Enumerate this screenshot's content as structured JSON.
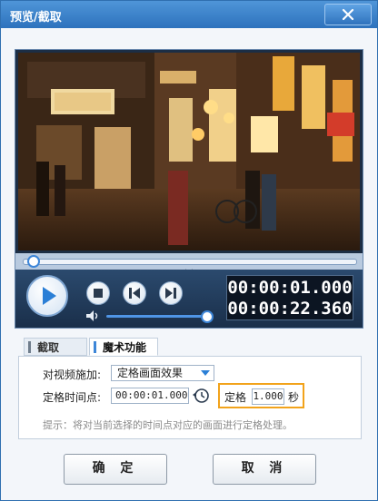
{
  "window": {
    "title": "预览/截取",
    "close_icon": "close-icon"
  },
  "player": {
    "current_time": "00:00:01.000",
    "total_time": "00:00:22.360",
    "seek_progress": 0.03,
    "volume_level": 0.97
  },
  "tabs": [
    {
      "label": "截取",
      "active": false
    },
    {
      "label": "魔术功能",
      "active": true
    }
  ],
  "form": {
    "effect_label": "对视频施加:",
    "effect_value": "定格画面效果",
    "timepoint_label": "定格时间点:",
    "timepoint_value": "00:00:01.000",
    "freeze_label": "定格",
    "freeze_value": "1.000",
    "freeze_unit": "秒",
    "hint": "提示：将对当前选择的时间点对应的画面进行定格处理。"
  },
  "buttons": {
    "ok": "确 定",
    "cancel": "取 消"
  },
  "colors": {
    "titlebar": "#3a82cc",
    "accent": "#3d86d8",
    "highlight": "#f2a31b"
  }
}
